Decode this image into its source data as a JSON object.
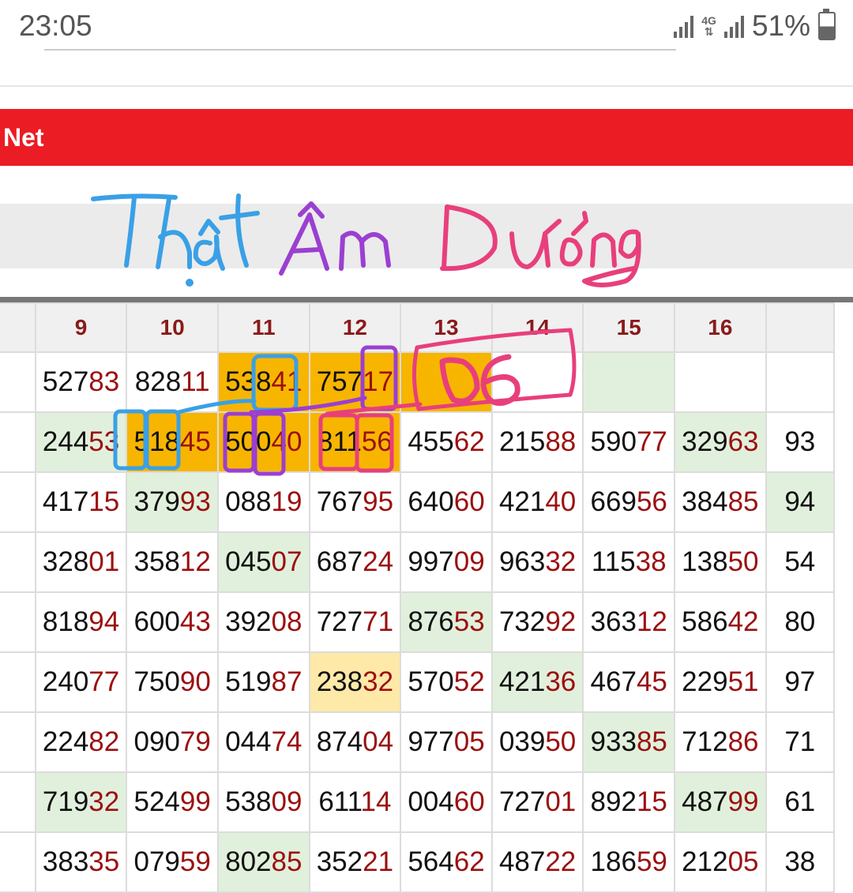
{
  "status_bar": {
    "time": "23:05",
    "network": "4G",
    "battery": "51%"
  },
  "header": {
    "label": "Net"
  },
  "annotation": {
    "handwritten_title": "Thật âm Dương",
    "circled_value": "06"
  },
  "table": {
    "columns": [
      "",
      "9",
      "10",
      "11",
      "12",
      "13",
      "14",
      "15",
      "16",
      ""
    ],
    "rows": [
      [
        {
          "h": "",
          "t": ""
        },
        {
          "h": "527",
          "t": "83"
        },
        {
          "h": "828",
          "t": "11"
        },
        {
          "h": "538",
          "t": "41",
          "c": "o"
        },
        {
          "h": "757",
          "t": "17",
          "c": "o"
        },
        {
          "h": "",
          "t": "",
          "c": "o"
        },
        {
          "h": "",
          "t": ""
        },
        {
          "h": "",
          "t": "",
          "c": "g"
        },
        {
          "h": "",
          "t": ""
        },
        {
          "h": "",
          "t": ""
        }
      ],
      [
        {
          "h": "",
          "t": ""
        },
        {
          "h": "244",
          "t": "53",
          "c": "g"
        },
        {
          "h": "518",
          "t": "45",
          "c": "o"
        },
        {
          "h": "500",
          "t": "40",
          "c": "o"
        },
        {
          "h": "811",
          "t": "56",
          "c": "o"
        },
        {
          "h": "455",
          "t": "62"
        },
        {
          "h": "215",
          "t": "88"
        },
        {
          "h": "590",
          "t": "77"
        },
        {
          "h": "329",
          "t": "63",
          "c": "g"
        },
        {
          "h": "93",
          "t": ""
        }
      ],
      [
        {
          "h": "",
          "t": ""
        },
        {
          "h": "417",
          "t": "15"
        },
        {
          "h": "379",
          "t": "93",
          "c": "g"
        },
        {
          "h": "088",
          "t": "19"
        },
        {
          "h": "767",
          "t": "95"
        },
        {
          "h": "640",
          "t": "60"
        },
        {
          "h": "421",
          "t": "40"
        },
        {
          "h": "669",
          "t": "56"
        },
        {
          "h": "384",
          "t": "85"
        },
        {
          "h": "94",
          "t": "",
          "c": "g"
        }
      ],
      [
        {
          "h": "",
          "t": ""
        },
        {
          "h": "328",
          "t": "01"
        },
        {
          "h": "358",
          "t": "12"
        },
        {
          "h": "045",
          "t": "07",
          "c": "g"
        },
        {
          "h": "687",
          "t": "24"
        },
        {
          "h": "997",
          "t": "09"
        },
        {
          "h": "963",
          "t": "32"
        },
        {
          "h": "115",
          "t": "38"
        },
        {
          "h": "138",
          "t": "50"
        },
        {
          "h": "54",
          "t": ""
        }
      ],
      [
        {
          "h": "",
          "t": ""
        },
        {
          "h": "818",
          "t": "94"
        },
        {
          "h": "600",
          "t": "43"
        },
        {
          "h": "392",
          "t": "08"
        },
        {
          "h": "727",
          "t": "71"
        },
        {
          "h": "876",
          "t": "53",
          "c": "g"
        },
        {
          "h": "732",
          "t": "92"
        },
        {
          "h": "363",
          "t": "12"
        },
        {
          "h": "586",
          "t": "42"
        },
        {
          "h": "80",
          "t": ""
        }
      ],
      [
        {
          "h": "",
          "t": ""
        },
        {
          "h": "240",
          "t": "77"
        },
        {
          "h": "750",
          "t": "90"
        },
        {
          "h": "519",
          "t": "87"
        },
        {
          "h": "238",
          "t": "32",
          "c": "y"
        },
        {
          "h": "570",
          "t": "52"
        },
        {
          "h": "421",
          "t": "36",
          "c": "g"
        },
        {
          "h": "467",
          "t": "45"
        },
        {
          "h": "229",
          "t": "51"
        },
        {
          "h": "97",
          "t": ""
        }
      ],
      [
        {
          "h": "",
          "t": ""
        },
        {
          "h": "224",
          "t": "82"
        },
        {
          "h": "090",
          "t": "79"
        },
        {
          "h": "044",
          "t": "74"
        },
        {
          "h": "874",
          "t": "04"
        },
        {
          "h": "977",
          "t": "05"
        },
        {
          "h": "039",
          "t": "50"
        },
        {
          "h": "933",
          "t": "85",
          "c": "g"
        },
        {
          "h": "712",
          "t": "86"
        },
        {
          "h": "71",
          "t": ""
        }
      ],
      [
        {
          "h": "",
          "t": ""
        },
        {
          "h": "719",
          "t": "32",
          "c": "g"
        },
        {
          "h": "524",
          "t": "99"
        },
        {
          "h": "538",
          "t": "09"
        },
        {
          "h": "611",
          "t": "14"
        },
        {
          "h": "004",
          "t": "60"
        },
        {
          "h": "727",
          "t": "01"
        },
        {
          "h": "892",
          "t": "15"
        },
        {
          "h": "487",
          "t": "99",
          "c": "g"
        },
        {
          "h": "61",
          "t": ""
        }
      ],
      [
        {
          "h": "",
          "t": ""
        },
        {
          "h": "383",
          "t": "35"
        },
        {
          "h": "079",
          "t": "59"
        },
        {
          "h": "802",
          "t": "85",
          "c": "g"
        },
        {
          "h": "352",
          "t": "21"
        },
        {
          "h": "564",
          "t": "62"
        },
        {
          "h": "487",
          "t": "22"
        },
        {
          "h": "186",
          "t": "59"
        },
        {
          "h": "212",
          "t": "05"
        },
        {
          "h": "38",
          "t": ""
        }
      ]
    ]
  },
  "colors": {
    "header_red": "#ec1c24",
    "highlight_orange": "#f7b500",
    "highlight_green": "#e1f0dc",
    "highlight_yellow": "#ffe9a8",
    "tail_red": "#9b1010",
    "ink_blue": "#3aa0e6",
    "ink_purple": "#9b3fd1",
    "ink_pink": "#e83f7c"
  }
}
